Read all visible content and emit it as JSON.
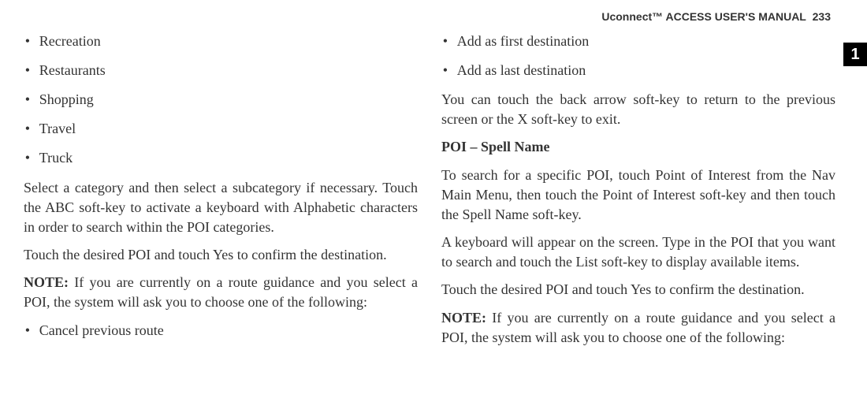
{
  "header": {
    "title": "Uconnect™ ACCESS USER'S MANUAL",
    "page": "233"
  },
  "tab": {
    "label": "1"
  },
  "left": {
    "bullets": [
      "Recreation",
      "Restaurants",
      "Shopping",
      "Travel",
      "Truck"
    ],
    "p1": "Select a category and then select a subcategory if necessary. Touch the ABC soft-key to activate a keyboard with Alphabetic characters in order to search within the POI categories.",
    "p2": "Touch the desired POI and touch Yes to confirm the destination.",
    "note_lead": "NOTE:",
    "note_body": " If you are currently on a route guidance and you select a POI, the system will ask you to choose one of the following:",
    "bullets2": [
      "Cancel previous route"
    ]
  },
  "right": {
    "bullets": [
      "Add as first destination",
      "Add as last destination"
    ],
    "p1": "You can touch the back arrow soft-key to return to the previous screen or the X soft-key to exit.",
    "sub": "POI – Spell Name",
    "p2": "To search for a specific POI, touch Point of Interest from the Nav Main Menu, then touch the Point of Interest soft-key and then touch the Spell Name soft-key.",
    "p3": "A keyboard will appear on the screen. Type in the POI that you want to search and touch the List soft-key to display available items.",
    "p4": "Touch the desired POI and touch Yes to confirm the destination.",
    "note_lead": "NOTE:",
    "note_body": " If you are currently on a route guidance and you select a POI, the system will ask you to choose one of the following:"
  }
}
